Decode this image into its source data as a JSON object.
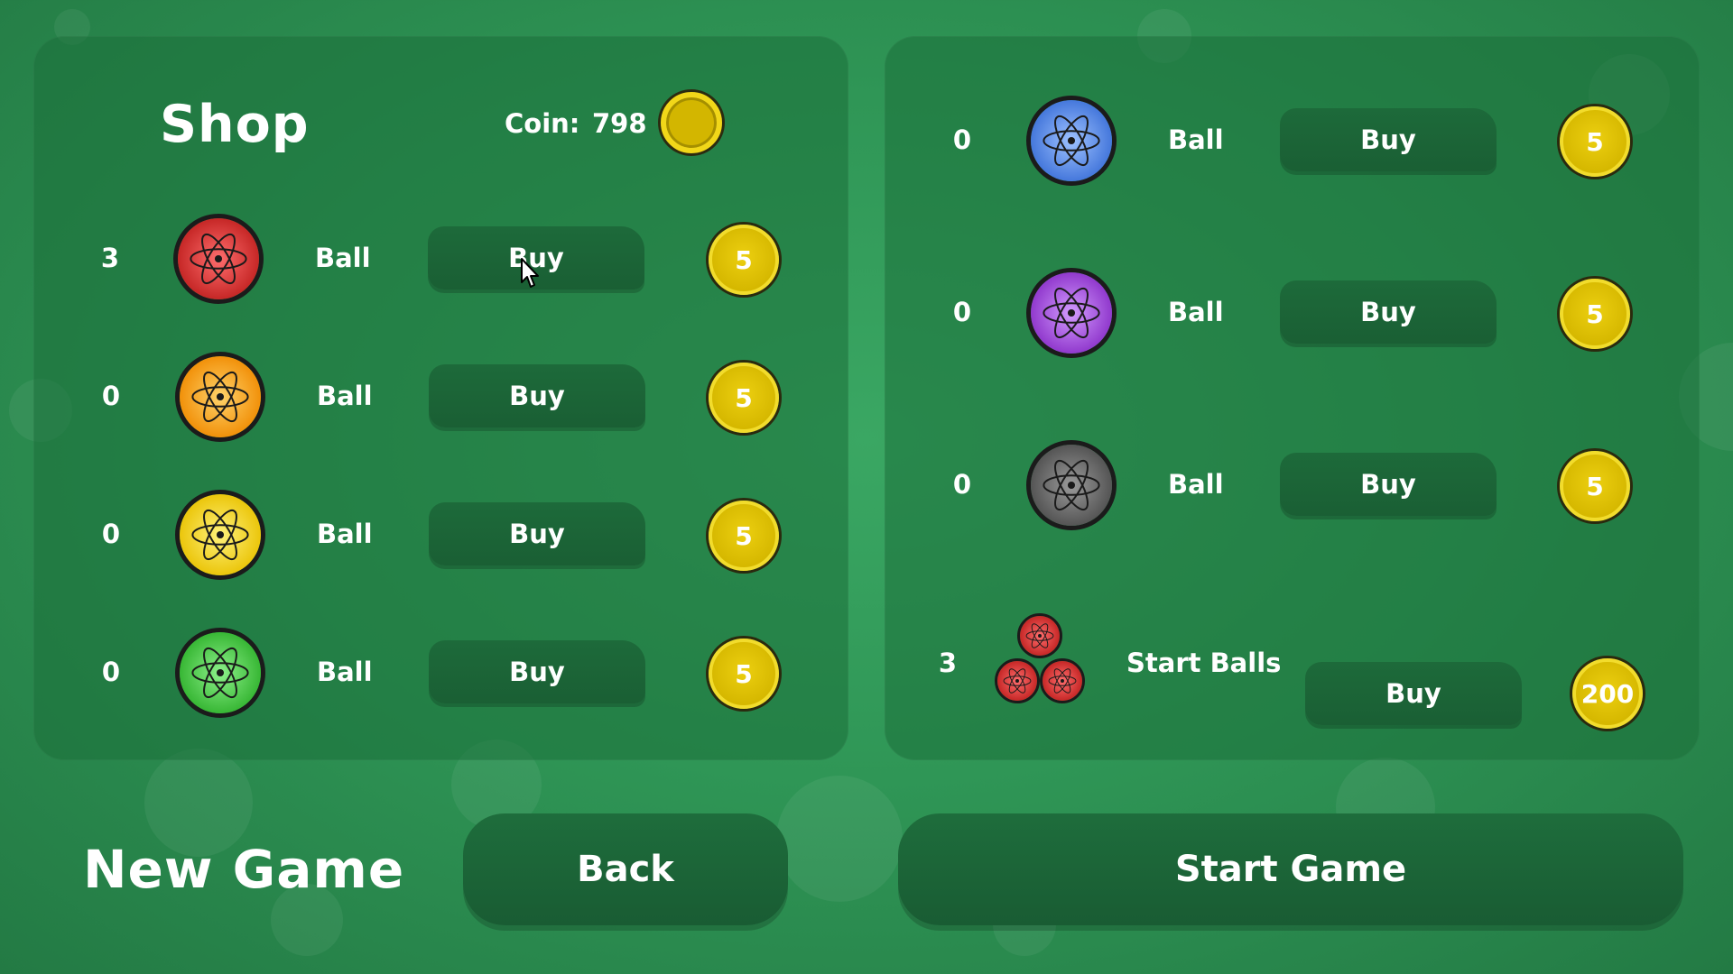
{
  "shop": {
    "title": "Shop",
    "coin_label": "Coin:",
    "coin_value": "798"
  },
  "left_items": [
    {
      "count": "3",
      "label": "Ball",
      "buy_label": "Buy",
      "price": "5",
      "color": "#c0201f",
      "glow": "#ff6d6d"
    },
    {
      "count": "0",
      "label": "Ball",
      "buy_label": "Buy",
      "price": "5",
      "color": "#f08a00",
      "glow": "#ffd36a"
    },
    {
      "count": "0",
      "label": "Ball",
      "buy_label": "Buy",
      "price": "5",
      "color": "#e9c100",
      "glow": "#fff27a"
    },
    {
      "count": "0",
      "label": "Ball",
      "buy_label": "Buy",
      "price": "5",
      "color": "#2fb12c",
      "glow": "#8df08a"
    }
  ],
  "right_items": [
    {
      "count": "0",
      "label": "Ball",
      "buy_label": "Buy",
      "price": "5",
      "color": "#3c70d8",
      "glow": "#9ec2ff"
    },
    {
      "count": "0",
      "label": "Ball",
      "buy_label": "Buy",
      "price": "5",
      "color": "#8a2fc8",
      "glow": "#d39cff"
    },
    {
      "count": "0",
      "label": "Ball",
      "buy_label": "Buy",
      "price": "5",
      "color": "#4e4e4e",
      "glow": "#9a9a9a"
    }
  ],
  "start_balls": {
    "count": "3",
    "label": "Start Balls",
    "buy_label": "Buy",
    "price": "200",
    "color": "#c0201f",
    "glow": "#ff6d6d"
  },
  "footer": {
    "new_game": "New Game",
    "back": "Back",
    "start_game": "Start Game"
  },
  "colors": {
    "background": "#2f9656",
    "panel": "#1c703a",
    "button": "#1b6236",
    "coin": "#d6b800"
  }
}
